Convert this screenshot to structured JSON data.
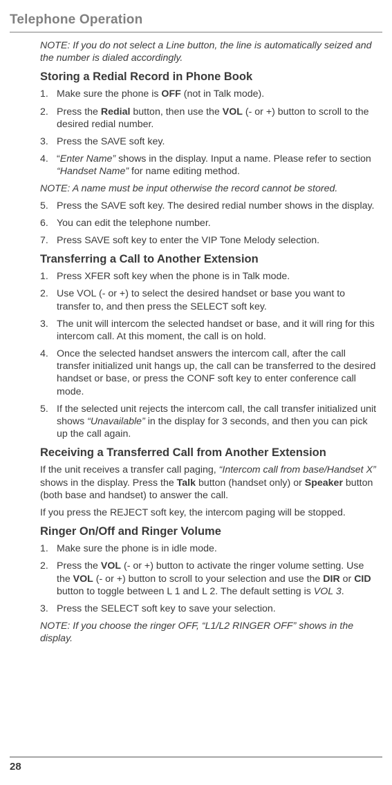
{
  "chapter": "Telephone Operation",
  "sections": {
    "note_top": "NOTE: If you do not select a Line button, the line is automatically seized and the number is dialed accordingly.",
    "storing": {
      "title": "Storing a Redial Record in Phone Book",
      "items": [
        "Make sure the phone is <b>OFF</b> (not in Talk mode).",
        "Press the <b>Redial</b> button, then use the <b>VOL</b> (- or +) button to scroll to the desired redial number.",
        "Press the SAVE soft key.",
        "“<i>Enter Name”</i> shows in the display. Input a name. Please refer to section <i>“Handset Name”</i> for name editing method."
      ],
      "note_mid": "NOTE: A name must be input otherwise the record cannot be stored.",
      "items2": [
        "Press the SAVE soft key. The desired redial number shows in the display.",
        "You can edit the telephone number.",
        "Press SAVE soft key to enter the VIP Tone Melody selection."
      ]
    },
    "transfer": {
      "title": "Transferring a Call to Another Extension",
      "items": [
        "Press XFER soft key when the phone is in Talk mode.",
        "Use VOL (- or +) to select the desired handset or base you want to transfer to, and then press the SELECT soft key.",
        "The unit will intercom the selected handset or base, and it will ring for this intercom call. At this moment, the call is on hold.",
        "Once the selected handset answers the intercom call, after the call transfer initialized unit hangs up, the call can be transferred to the desired handset or base, or press the CONF soft key to enter conference call mode.",
        "If the selected unit rejects the intercom call, the call transfer initialized unit shows <i>“Unavailable”</i> in the display for 3 seconds, and then you can pick up the call again."
      ]
    },
    "receive": {
      "title": "Receiving a Transferred Call from Another Extension",
      "p1": "If the unit receives a transfer call paging, <i>“Intercom call from base/Handset X”</i> shows in the display. Press the <b>Talk</b> button (handset only) or <b>Speaker</b> button (both base and handset) to answer the call.",
      "p2": "If you press the REJECT soft key, the intercom paging will be stopped."
    },
    "ringer": {
      "title": "Ringer On/Off and Ringer Volume",
      "items": [
        "Make sure the phone is in idle mode.",
        "Press the <b>VOL</b> (- or +) button to activate the ringer volume setting. Use the <b>VOL</b> (- or +) button to scroll to your selection and use the <b>DIR</b> or <b>CID</b> button to toggle between L 1 and L 2. The default setting is <i>VOL 3</i>.",
        "Press the SELECT soft key to save your selection."
      ],
      "note": "NOTE: If you choose the ringer OFF, “L1/L2 RINGER OFF” shows in the display."
    }
  },
  "page": "28"
}
